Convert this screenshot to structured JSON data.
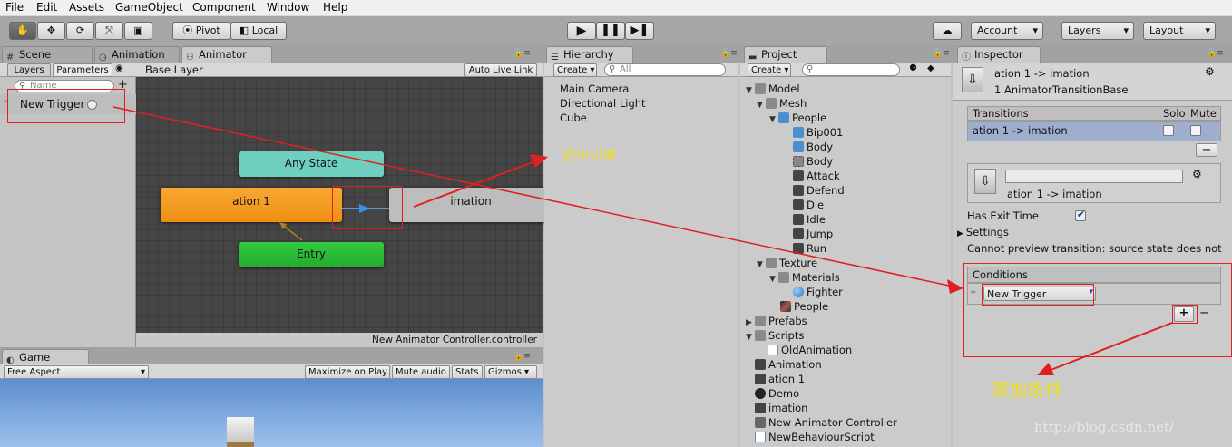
{
  "menu": [
    "File",
    "Edit",
    "Assets",
    "GameObject",
    "Component",
    "Window",
    "Help"
  ],
  "toolbar": {
    "pivot": "Pivot",
    "local": "Local",
    "account": "Account",
    "layers": "Layers",
    "layout": "Layout"
  },
  "tabs": {
    "scene": "Scene",
    "animation": "Animation",
    "animator": "Animator",
    "hierarchy": "Hierarchy",
    "project": "Project",
    "inspector": "Inspector",
    "game": "Game"
  },
  "animator": {
    "layers_tab": "Layers",
    "parameters_tab": "Parameters",
    "base_layer": "Base Layer",
    "auto_live_link": "Auto Live Link",
    "search_placeholder": "Name",
    "param_name": "New Trigger",
    "nodes": {
      "any_state": "Any State",
      "ation1": "ation 1",
      "imation": "imation",
      "entry": "Entry"
    },
    "footer": "New Animator Controller.controller"
  },
  "hierarchy": {
    "create": "Create",
    "search": "All",
    "items": [
      "Main Camera",
      "Directional Light",
      "Cube"
    ]
  },
  "project": {
    "create": "Create",
    "tree": {
      "model": "Model",
      "mesh": "Mesh",
      "people": "People",
      "bip001": "Bip001",
      "body1": "Body",
      "body2": "Body",
      "attack": "Attack",
      "defend": "Defend",
      "die": "Die",
      "idle": "Idle",
      "jump": "Jump",
      "run": "Run",
      "texture": "Texture",
      "materials": "Materials",
      "fighter": "Fighter",
      "people2": "People",
      "prefabs": "Prefabs",
      "scripts": "Scripts",
      "oldanimation": "OldAnimation",
      "animation": "Animation",
      "ation1": "ation 1",
      "demo": "Demo",
      "imation": "imation",
      "controller": "New Animator Controller",
      "script": "NewBehaviourScript"
    }
  },
  "inspector": {
    "header_title": "ation 1 -> imation",
    "header_sub": "1 AnimatorTransitionBase",
    "transitions_label": "Transitions",
    "solo": "Solo",
    "mute": "Mute",
    "transition_row": "ation 1 -> imation",
    "transition_name": "ation 1 -> imation",
    "has_exit_time": "Has Exit Time",
    "settings": "Settings",
    "preview_msg": "Cannot preview transition: source state does not",
    "conditions": "Conditions",
    "condition_value": "New Trigger"
  },
  "game": {
    "aspect": "Free Aspect",
    "maximize": "Maximize on Play",
    "mute_audio": "Mute audio",
    "stats": "Stats",
    "gizmos": "Gizmos"
  },
  "annotations": {
    "select_transition": "选中过度",
    "add_condition": "添加条件"
  },
  "watermark": "http://blog.csdn.net/",
  "colors": {
    "orange": "#f29a1e",
    "teal": "#6fcfbf",
    "green": "#2fbf3a",
    "grey_node": "#bdbdbd",
    "annotation": "#e02020",
    "annotation_text": "#f0e020"
  }
}
